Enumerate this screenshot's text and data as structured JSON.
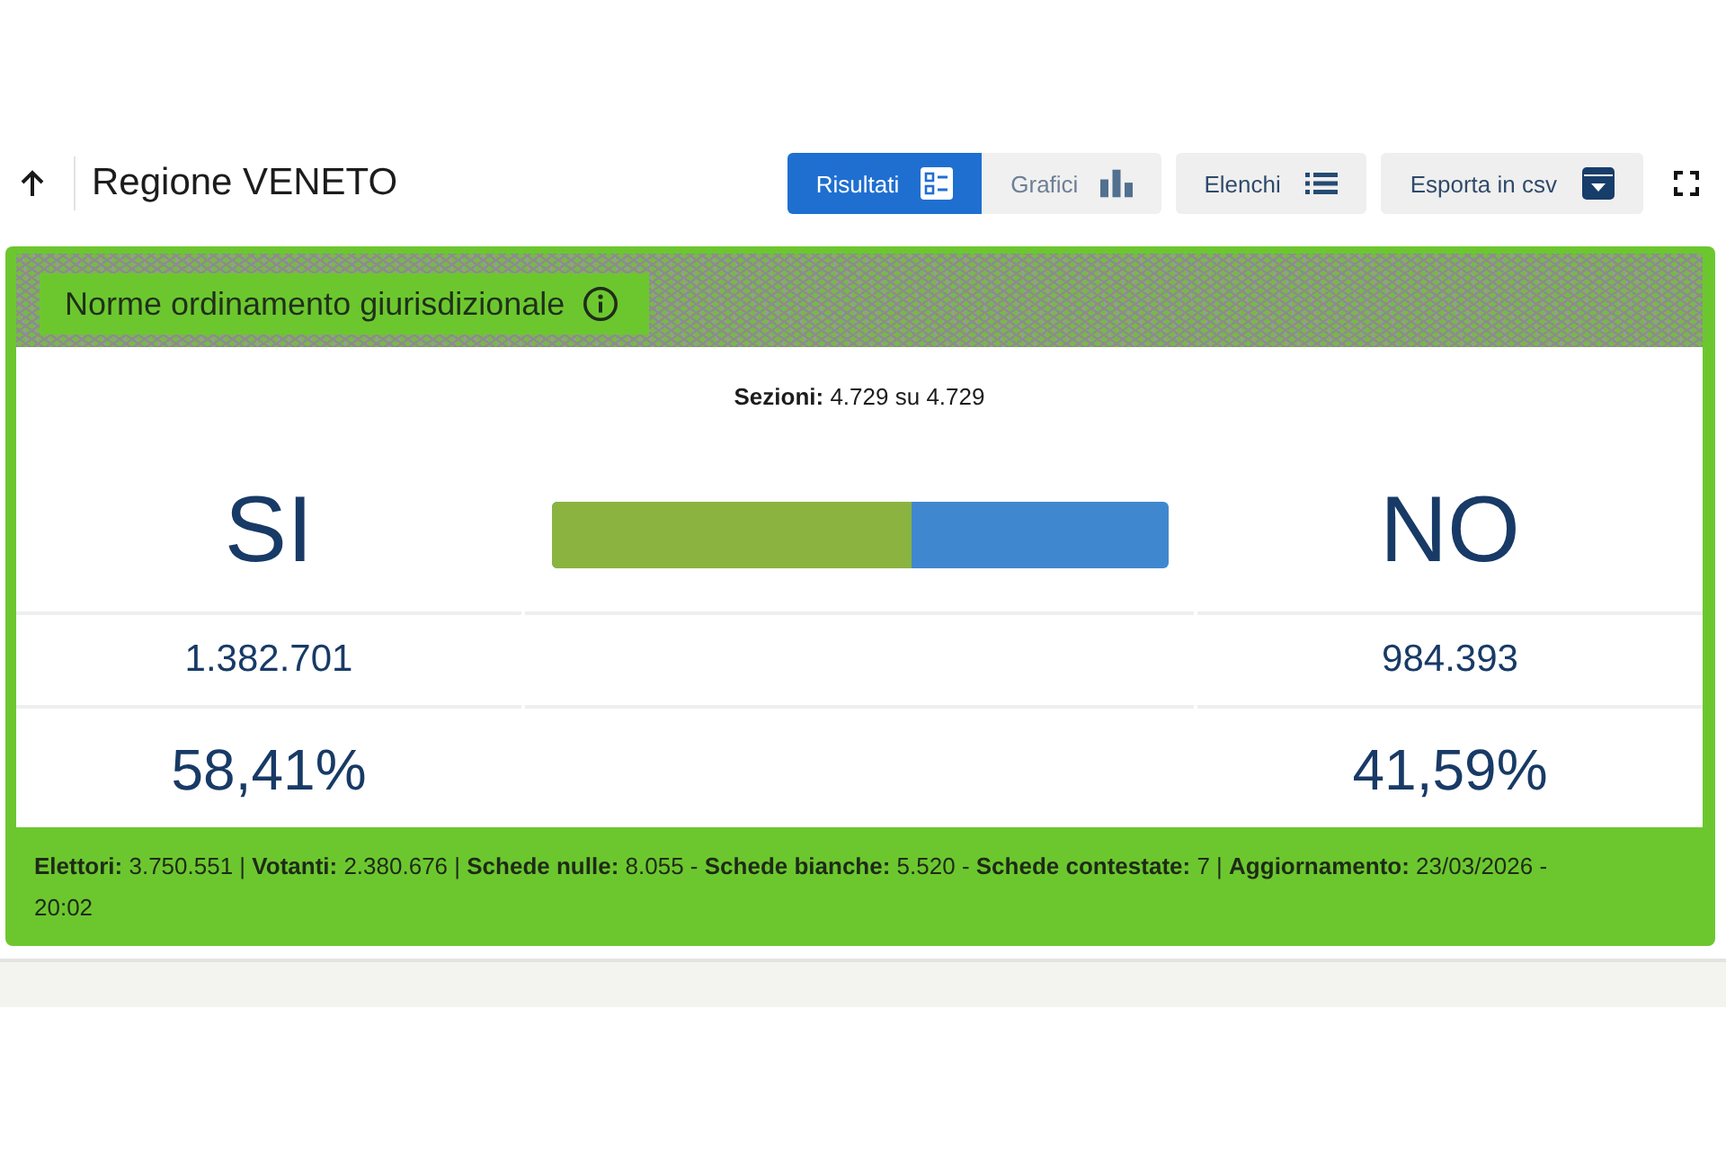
{
  "header": {
    "title": "Regione VENETO",
    "view_tabs": [
      {
        "label": "Risultati",
        "kind": "results",
        "selected": true
      },
      {
        "label": "Grafici",
        "kind": "charts",
        "selected": false
      }
    ],
    "buttons": [
      {
        "label": "Elenchi",
        "kind": "lists"
      },
      {
        "label": "Esporta in csv",
        "kind": "export"
      }
    ]
  },
  "card": {
    "title": "Norme ordinamento giurisdizionale",
    "sections": "**Sezioni:** 4.729 su 4.729",
    "options": [
      {
        "label": "SI",
        "votes": "1.382.701",
        "percent": "58,41%"
      },
      {
        "label": "NO",
        "votes": "984.393",
        "percent": "41,59%"
      }
    ],
    "result_bar": {
      "level": 0.5841
    },
    "footer": "**Elettori:** 3.750.551 | **Votanti:** 2.380.676 | **Schede nulle:** 8.055 - **Schede bianche:** 5.520 - **Schede contestate:** 7 | **Aggiornamento:** 23/03/2026 - 20:02"
  }
}
